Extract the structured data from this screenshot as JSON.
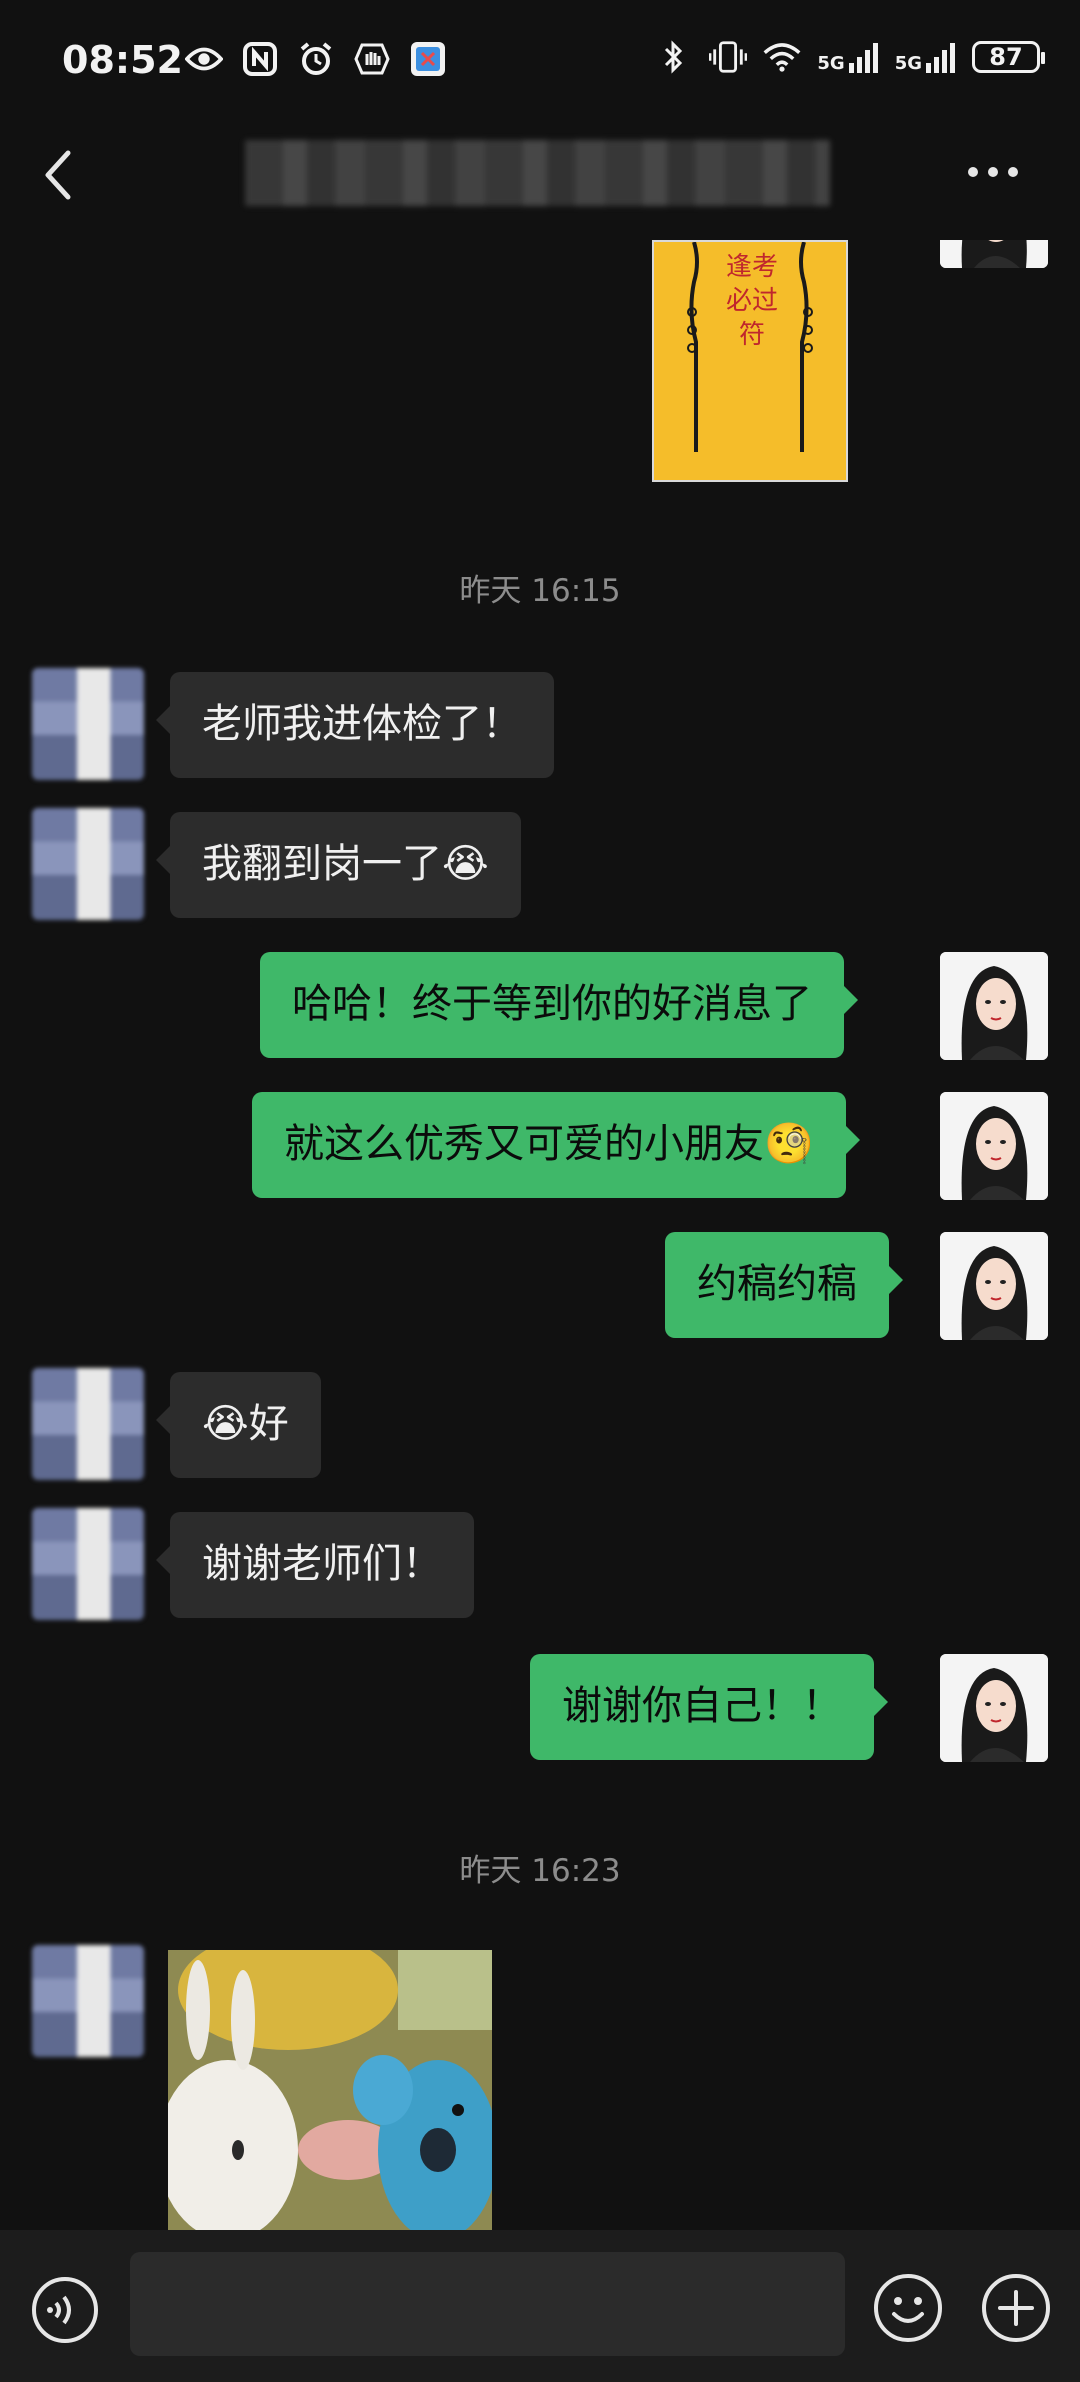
{
  "status_bar": {
    "time": "08:52",
    "left_icons": [
      "eye-icon",
      "nfc-icon",
      "alarm-icon",
      "hand-icon",
      "app-badge-icon"
    ],
    "signal_1": "5G",
    "signal_2": "5G",
    "battery": "87"
  },
  "header": {
    "back_icon": "chevron-left-icon",
    "more_icon": "more-icon"
  },
  "chat": {
    "sticker_top": {
      "lines": [
        "逢考",
        "必过",
        "符"
      ],
      "bg_color": "#f5bd2a"
    },
    "timestamp_1": "昨天 16:15",
    "messages": [
      {
        "side": "in",
        "text": "老师我进体检了！"
      },
      {
        "side": "in",
        "text": "我翻到岗一了",
        "emoji": "😭"
      },
      {
        "side": "out",
        "text": "哈哈！终于等到你的好消息了"
      },
      {
        "side": "out",
        "text": "就这么优秀又可爱的小朋友",
        "emoji": "🧐"
      },
      {
        "side": "out",
        "text": "约稿约稿"
      },
      {
        "side": "in",
        "text": "好",
        "emoji": "😭"
      },
      {
        "side": "in",
        "text": "谢谢老师们！"
      },
      {
        "side": "out",
        "text": "谢谢你自己！！"
      }
    ],
    "timestamp_2": "昨天 16:23"
  },
  "input_bar": {
    "voice_icon": "voice-icon",
    "emoji_icon": "smile-icon",
    "plus_icon": "plus-icon"
  },
  "colors": {
    "background": "#111111",
    "bubble_in": "#2c2c2c",
    "bubble_out": "#3fb869"
  }
}
